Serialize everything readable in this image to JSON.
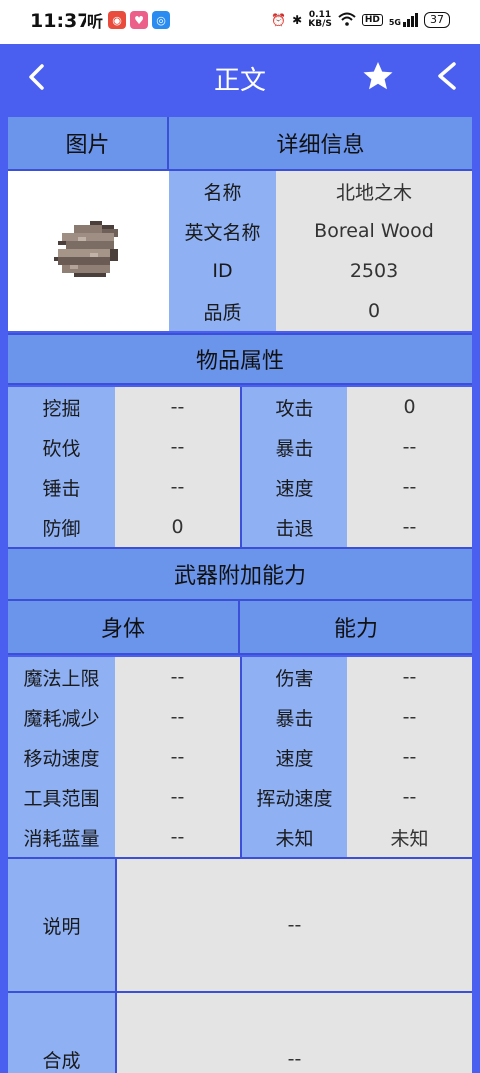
{
  "status_bar": {
    "time": "11:37",
    "net_speed_top": "0.11",
    "net_speed_unit": "KB/S",
    "hd": "HD",
    "signal": "5G",
    "battery": "37"
  },
  "app_bar": {
    "title": "正文",
    "back_icon": "chevron-left-icon",
    "favorite_icon": "star-icon",
    "share_icon": "share-icon",
    "color": "#4a5ff0"
  },
  "info": {
    "image_header": "图片",
    "detail_header": "详细信息",
    "rows": [
      {
        "label": "名称",
        "value": "北地之木"
      },
      {
        "label": "英文名称",
        "value": "Boreal Wood"
      },
      {
        "label": "ID",
        "value": "2503"
      },
      {
        "label": "品质",
        "value": "0"
      }
    ]
  },
  "properties": {
    "header": "物品属性",
    "rows": [
      {
        "l1": "挖掘",
        "v1": "--",
        "l2": "攻击",
        "v2": "0"
      },
      {
        "l1": "砍伐",
        "v1": "--",
        "l2": "暴击",
        "v2": "--"
      },
      {
        "l1": "锤击",
        "v1": "--",
        "l2": "速度",
        "v2": "--"
      },
      {
        "l1": "防御",
        "v1": "0",
        "l2": "击退",
        "v2": "--"
      }
    ]
  },
  "weapon": {
    "header": "武器附加能力",
    "body_header": "身体",
    "ability_header": "能力",
    "rows": [
      {
        "l1": "魔法上限",
        "v1": "--",
        "l2": "伤害",
        "v2": "--"
      },
      {
        "l1": "魔耗减少",
        "v1": "--",
        "l2": "暴击",
        "v2": "--"
      },
      {
        "l1": "移动速度",
        "v1": "--",
        "l2": "速度",
        "v2": "--"
      },
      {
        "l1": "工具范围",
        "v1": "--",
        "l2": "挥动速度",
        "v2": "--"
      },
      {
        "l1": "消耗蓝量",
        "v1": "--",
        "l2": "未知",
        "v2": "未知"
      }
    ]
  },
  "description": {
    "label": "说明",
    "value": "--"
  },
  "crafting": {
    "label": "合成",
    "value": "--"
  }
}
